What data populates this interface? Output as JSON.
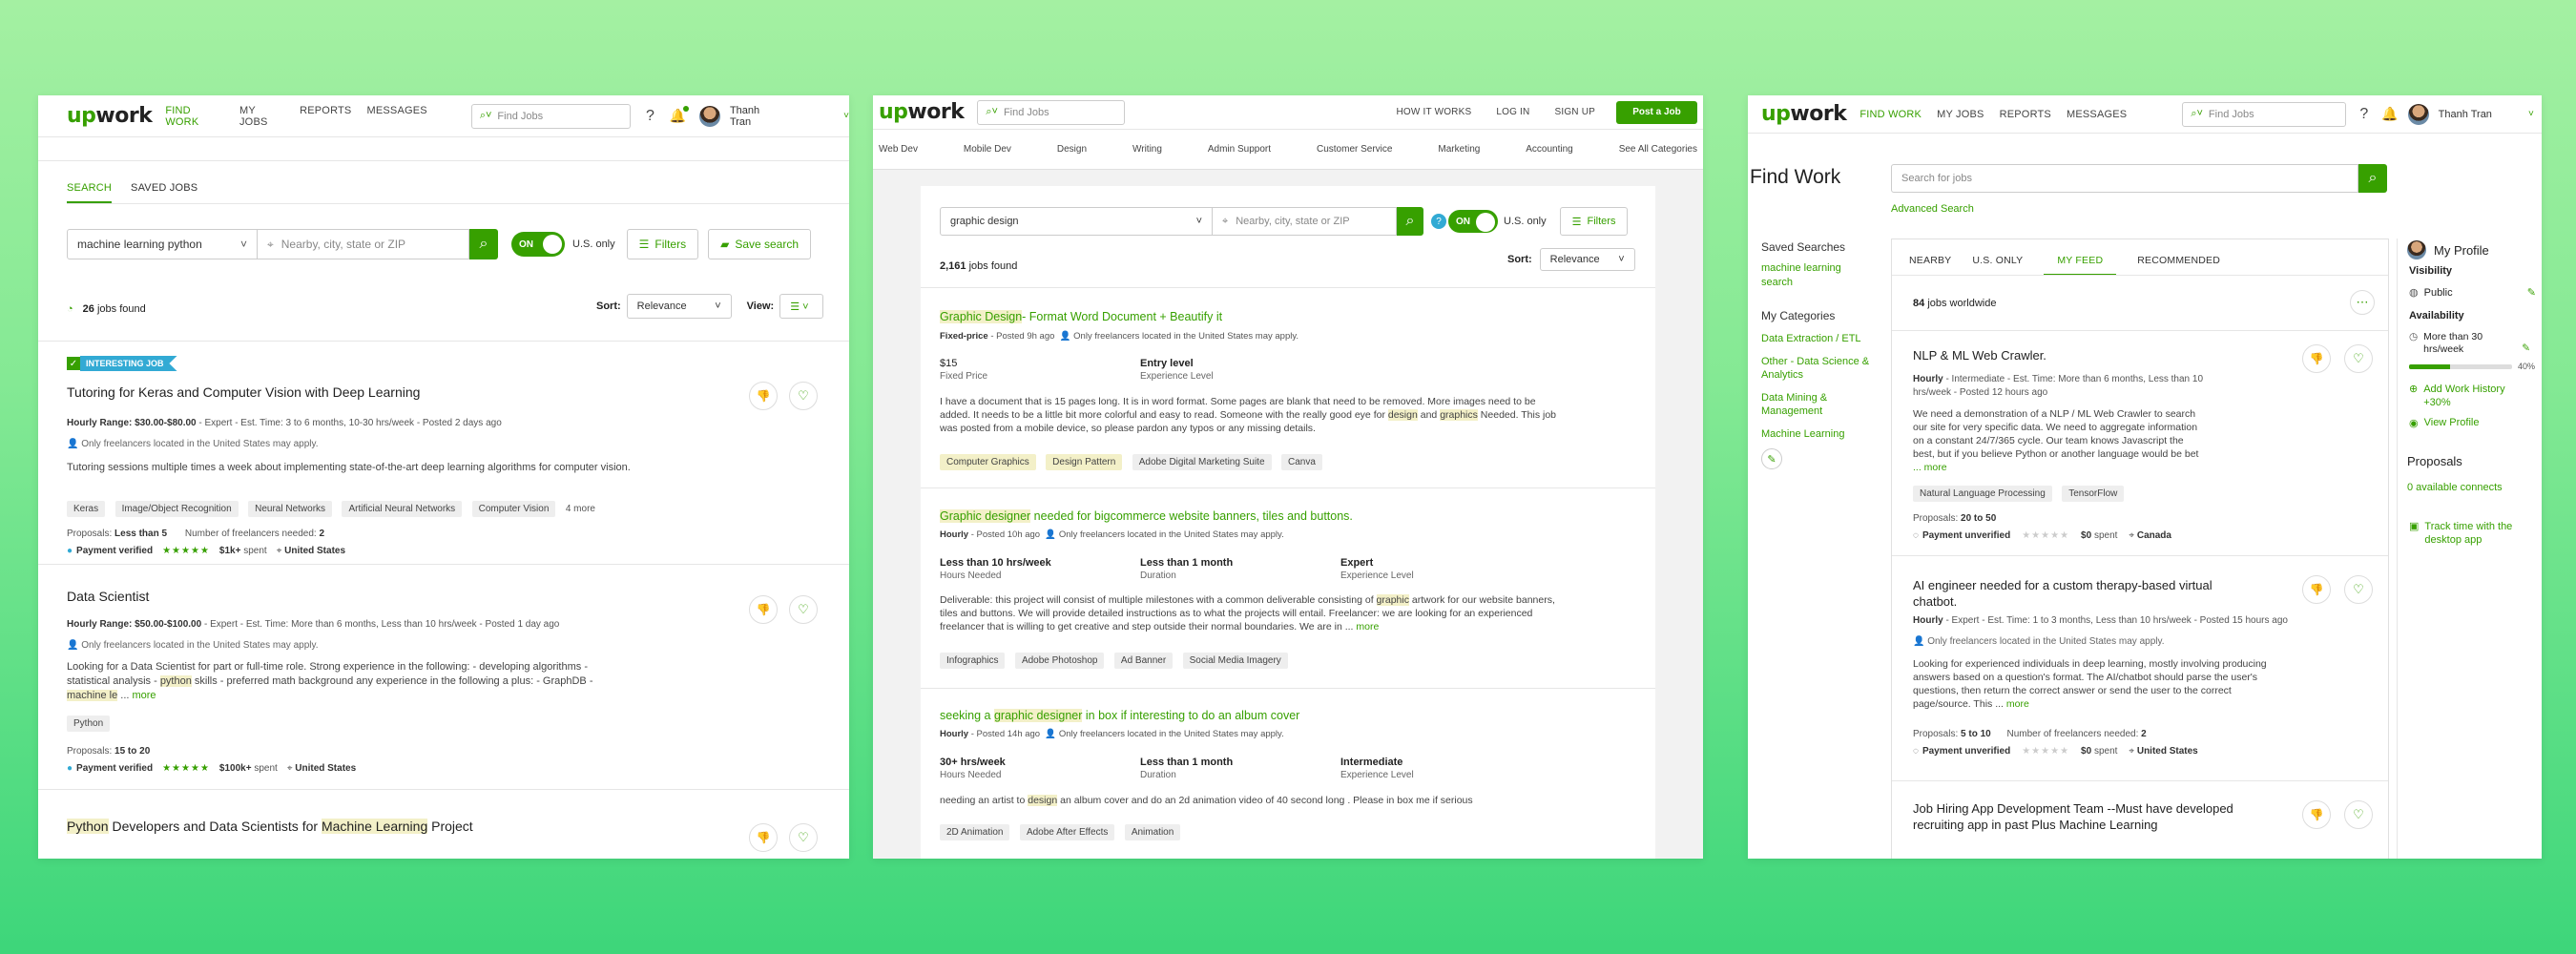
{
  "panel1": {
    "nav": [
      "FIND WORK",
      "MY JOBS",
      "REPORTS",
      "MESSAGES"
    ],
    "search_placeholder": "Find Jobs",
    "user": "Thanh Tran",
    "tabs": [
      "SEARCH",
      "SAVED JOBS"
    ],
    "query": "machine learning python",
    "location_placeholder": "Nearby, city, state or ZIP",
    "toggle": "ON",
    "us_only": "U.S. only",
    "filters": "Filters",
    "save_search": "Save search",
    "jobs_count": "26",
    "jobs_found": "jobs found",
    "sort_label": "Sort:",
    "sort_value": "Relevance",
    "view_label": "View:",
    "jobs": [
      {
        "badge": "INTERESTING JOB",
        "title": "Tutoring for Keras and Computer Vision with Deep Learning",
        "meta_a": "Hourly Range: $30.00-$80.00",
        "meta_b": " - Expert - Est. Time: 3 to 6 months, 10-30 hrs/week - Posted 2 days ago",
        "loc_note": "Only freelancers located in the United States may apply.",
        "desc": "Tutoring sessions multiple times a week about implementing state-of-the-art deep learning algorithms for computer vision.",
        "tags": [
          "Keras",
          "Image/Object Recognition",
          "Neural Networks",
          "Artificial Neural Networks",
          "Computer Vision"
        ],
        "more_tags": "4 more",
        "proposals_label": "Proposals:",
        "proposals": "Less than 5",
        "needed_label": "Number of freelancers needed:",
        "needed": "2",
        "payment": "Payment verified",
        "stars": "★★★★★",
        "spent": "$1k+",
        "spent_label": "spent",
        "country": "United States"
      },
      {
        "title": "Data Scientist",
        "meta_a": "Hourly Range: $50.00-$100.00",
        "meta_b": " - Expert - Est. Time: More than 6 months, Less than 10 hrs/week - Posted 1 day ago",
        "loc_note": "Only freelancers located in the United States may apply.",
        "desc_1": "Looking for a Data Scientist for part or full-time role. Strong experience in the following: - developing algorithms -",
        "desc_2a": "statistical analysis - ",
        "desc_2h": "python",
        "desc_2b": " skills - preferred math background any experience in the following a plus: - GraphDB -",
        "desc_3h": "machine le",
        "desc_3b": " ... ",
        "more": "more",
        "tags": [
          "Python"
        ],
        "proposals_label": "Proposals:",
        "proposals": "15 to 20",
        "payment": "Payment verified",
        "stars": "★★★★★",
        "spent": "$100k+",
        "spent_label": "spent",
        "country": "United States"
      },
      {
        "title_h1": "Python",
        "title_m": " Developers and Data Scientists for ",
        "title_h2": "Machine Learning",
        "title_e": " Project"
      }
    ]
  },
  "panel2": {
    "search_placeholder": "Find Jobs",
    "nav": [
      "HOW IT WORKS",
      "LOG IN",
      "SIGN UP"
    ],
    "post_job": "Post a Job",
    "categories": [
      "Web Dev",
      "Mobile Dev",
      "Design",
      "Writing",
      "Admin Support",
      "Customer Service",
      "Marketing",
      "Accounting",
      "See All Categories"
    ],
    "query": "graphic design",
    "location_placeholder": "Nearby, city, state or ZIP",
    "toggle": "ON",
    "us_only": "U.S. only",
    "filters": "Filters",
    "help": "?",
    "jobs_count": "2,161",
    "jobs_found": "jobs found",
    "sort_label": "Sort:",
    "sort_value": "Relevance",
    "jobs": [
      {
        "title_h": "Graphic Design",
        "title_r": "- Format Word Document + Beautify it",
        "type": "Fixed-price",
        "posted": " - Posted 9h ago",
        "loc_note": "Only freelancers located in the United States may apply.",
        "c1v": "$15",
        "c1l": "Fixed Price",
        "c2v": "Entry level",
        "c2l": "Experience Level",
        "d1": "I have a document that is 15 pages long. It is in word format. Some pages are blank that need to be removed. More images need to be",
        "d2": "added. It needs to be a little bit more colorful and easy to read. Someone with the really good eye for ",
        "d2h1": "design",
        "d2m": " and ",
        "d2h2": "graphics",
        "d2e": " Needed. This job",
        "d3": "was posted from a mobile device, so please pardon any typos or any missing details.",
        "tags": [
          "Computer Graphics",
          "Design Pattern",
          "Adobe Digital Marketing Suite",
          "Canva"
        ]
      },
      {
        "title_h": "Graphic designer",
        "title_r": " needed for bigcommerce website banners, tiles and buttons.",
        "type": "Hourly",
        "posted": " - Posted 10h ago",
        "loc_note": "Only freelancers located in the United States may apply.",
        "c1v": "Less than 10 hrs/week",
        "c1l": "Hours Needed",
        "c2v": "Less than 1 month",
        "c2l": "Duration",
        "c3v": "Expert",
        "c3l": "Experience Level",
        "d1": "Deliverable: this project will consist of multiple milestones with a common deliverable consisting of ",
        "d1h": "graphic",
        "d1e": " artwork for our website banners,",
        "d2": "tiles and buttons. We will provide detailed instructions as to what the projects will entail. Freelancer: we are looking for an experienced",
        "d3": "freelancer that is willing to get creative and step outside their normal boundaries. We are in ... ",
        "more": "more",
        "tags": [
          "Infographics",
          "Adobe Photoshop",
          "Ad Banner",
          "Social Media Imagery"
        ]
      },
      {
        "title_a": "seeking a ",
        "title_h": "graphic designer",
        "title_r": " in box if interesting to do an album cover",
        "type": "Hourly",
        "posted": " - Posted 14h ago",
        "loc_note": "Only freelancers located in the United States may apply.",
        "c1v": "30+ hrs/week",
        "c1l": "Hours Needed",
        "c2v": "Less than 1 month",
        "c2l": "Duration",
        "c3v": "Intermediate",
        "c3l": "Experience Level",
        "d1": "needing an artist to ",
        "d1h": "design",
        "d1e": " an album cover and do an 2d animation video of 40 second long . Please in box me if serious",
        "tags": [
          "2D Animation",
          "Adobe After Effects",
          "Animation"
        ]
      }
    ]
  },
  "panel3": {
    "nav": [
      "FIND WORK",
      "MY JOBS",
      "REPORTS",
      "MESSAGES"
    ],
    "search_placeholder": "Find Jobs",
    "user": "Thanh Tran",
    "heading": "Find Work",
    "search_input_placeholder": "Search for jobs",
    "advanced": "Advanced Search",
    "saved_title": "Saved Searches",
    "saved_item": "machine learning search",
    "cat_title": "My Categories",
    "cats": [
      "Data Extraction / ETL",
      "Other - Data Science & Analytics",
      "Data Mining & Management",
      "Machine Learning"
    ],
    "tabs": [
      "NEARBY",
      "U.S. ONLY",
      "MY FEED",
      "RECOMMENDED"
    ],
    "count": "84",
    "count_label": "jobs worldwide",
    "jobs": [
      {
        "title": "NLP & ML Web Crawler.",
        "meta": "Hourly",
        "meta_r": " - Intermediate - Est. Time: More than 6 months, Less than 10",
        "meta2": "hrs/week - Posted 12 hours ago",
        "d1": "We need a demonstration of a NLP / ML Web Crawler to search",
        "d2": "our site for very specific data. We need to aggregate information",
        "d3": "on a constant 24/7/365 cycle. Our team knows Javascript the",
        "d4": "best, but if you believe Python or another language would be bet",
        "more": "... more",
        "tags": [
          "Natural Language Processing",
          "TensorFlow"
        ],
        "proposals_label": "Proposals:",
        "proposals": "20 to 50",
        "payment": "Payment unverified",
        "stars": "★★★★★",
        "spent": "$0",
        "spent_label": "spent",
        "country": "Canada"
      },
      {
        "title": "AI engineer needed for a custom therapy-based virtual",
        "title2": "chatbot.",
        "meta": "Hourly",
        "meta_r": " - Expert - Est. Time: 1 to 3 months, Less than 10 hrs/week - Posted 15 hours ago",
        "loc_note": "Only freelancers located in the United States may apply.",
        "d1": "Looking for experienced individuals in deep learning, mostly involving producing",
        "d2": "answers based on a question's format. The AI/chatbot should parse the user's",
        "d3": "questions, then return the correct answer or send the user to the correct",
        "d4": "page/source. This ... ",
        "more": "more",
        "proposals_label": "Proposals:",
        "proposals": "5 to 10",
        "needed_label": "Number of freelancers needed:",
        "needed": "2",
        "payment": "Payment unverified",
        "stars": "★★★★★",
        "spent": "$0",
        "spent_label": "spent",
        "country": "United States"
      },
      {
        "title": "Job Hiring App Development Team --Must have developed",
        "title2": "recruiting app in past Plus Machine Learning"
      }
    ],
    "profile": {
      "title": "My Profile",
      "visibility": "Visibility",
      "public": "Public",
      "availability": "Availability",
      "avail_value": "More than 30 hrs/week",
      "progress": 40,
      "progress_label": "40%",
      "add_history": "Add Work History +30%",
      "view_profile": "View Profile",
      "proposals_title": "Proposals",
      "connects": "0 available connects",
      "track": "Track time with the desktop app"
    }
  }
}
